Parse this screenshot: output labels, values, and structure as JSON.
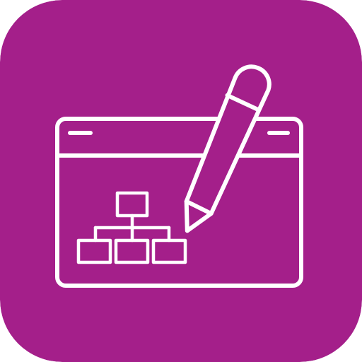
{
  "icon": {
    "name": "flowchart-editor-app-icon",
    "background_color": "#A41F8A",
    "stroke_color": "#FFFFFF",
    "elements": [
      "browser-window-icon",
      "hierarchy-diagram-icon",
      "pencil-icon"
    ]
  }
}
